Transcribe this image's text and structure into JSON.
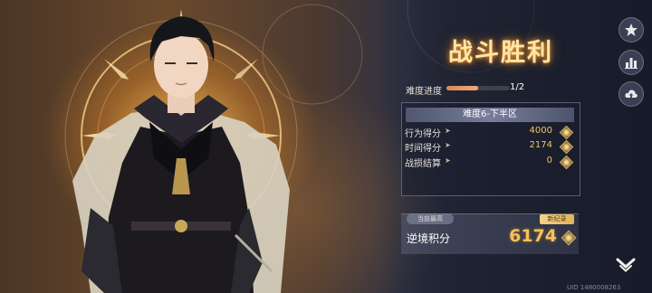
{
  "result": {
    "title": "战斗胜利"
  },
  "progress": {
    "label": "难度进度",
    "value": "1/2",
    "fraction": 0.5
  },
  "scores": {
    "header": "难度6-下半区",
    "rows": [
      {
        "label": "行为得分",
        "value": "4000"
      },
      {
        "label": "时间得分",
        "value": "2174"
      },
      {
        "label": "战损结算",
        "value": "0"
      }
    ]
  },
  "total": {
    "best_tag": "当前最高",
    "label": "逆境积分",
    "value": "6174",
    "new_record": "新纪录"
  },
  "side_buttons": [
    "star-icon",
    "bar-chart-icon",
    "cloud-upload-icon"
  ],
  "footer": {
    "uid": "UID 1480008263"
  },
  "colors": {
    "accent": "#f6c15a",
    "title_glow": "#ffe6a8",
    "progress": "#e8976a"
  }
}
